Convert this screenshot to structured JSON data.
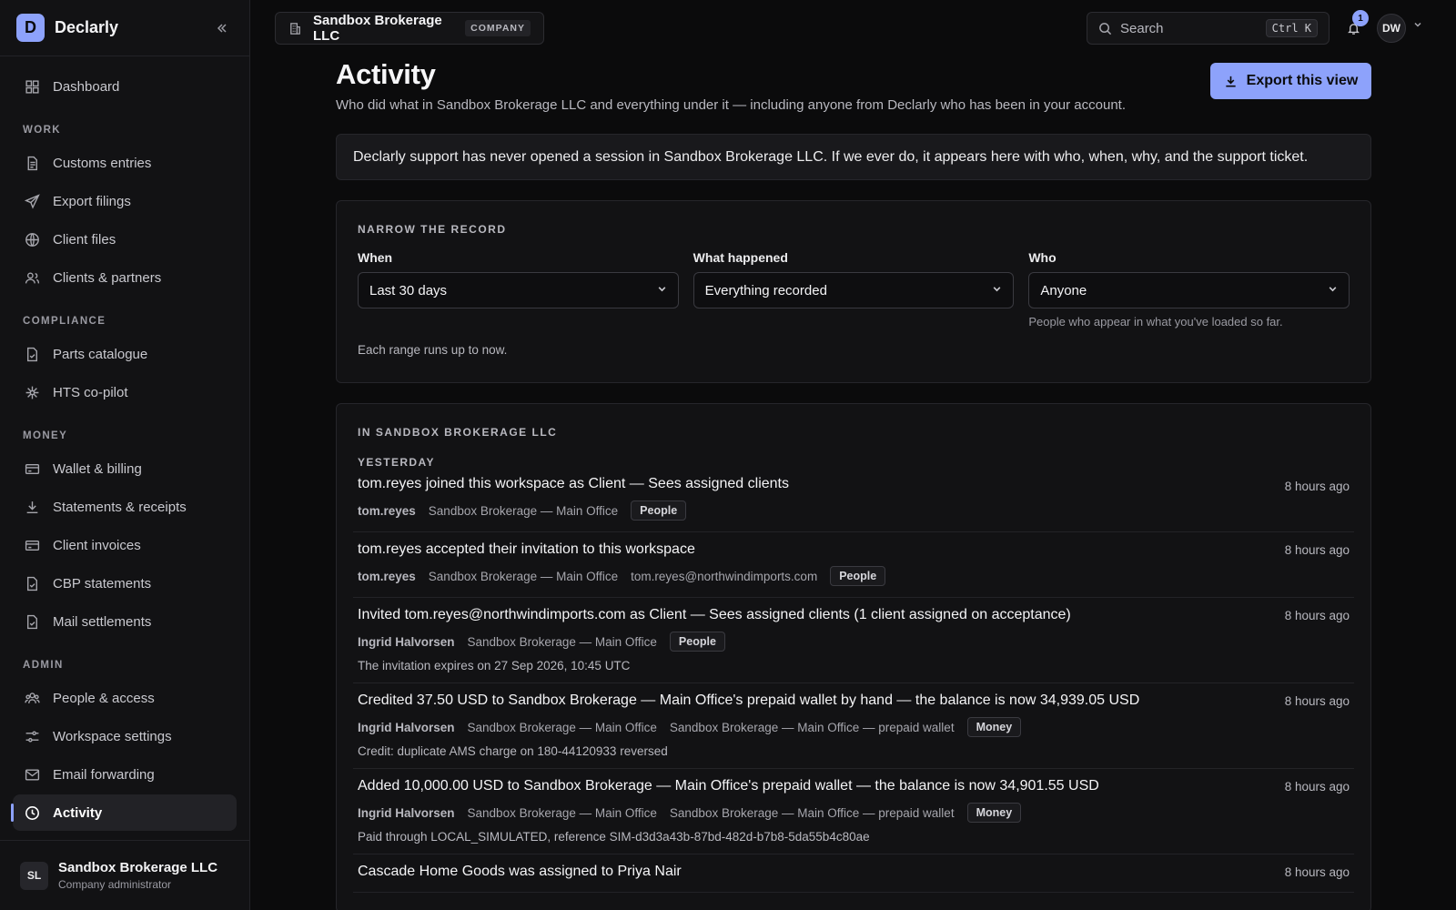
{
  "brand": {
    "logo_letter": "D",
    "name": "Declarly"
  },
  "sidebar": {
    "top_items": [
      {
        "label": "Dashboard",
        "icon": "grid-icon"
      }
    ],
    "sections": [
      {
        "title": "WORK",
        "items": [
          {
            "label": "Customs entries",
            "icon": "document-icon"
          },
          {
            "label": "Export filings",
            "icon": "send-icon"
          },
          {
            "label": "Client files",
            "icon": "globe-icon"
          },
          {
            "label": "Clients & partners",
            "icon": "users-icon"
          }
        ]
      },
      {
        "title": "COMPLIANCE",
        "items": [
          {
            "label": "Parts catalogue",
            "icon": "file-check-icon"
          },
          {
            "label": "HTS co-pilot",
            "icon": "sparkle-icon"
          }
        ]
      },
      {
        "title": "MONEY",
        "items": [
          {
            "label": "Wallet & billing",
            "icon": "card-icon"
          },
          {
            "label": "Statements & receipts",
            "icon": "download-icon"
          },
          {
            "label": "Client invoices",
            "icon": "card-icon"
          },
          {
            "label": "CBP statements",
            "icon": "file-check-icon"
          },
          {
            "label": "Mail settlements",
            "icon": "file-check-icon"
          }
        ]
      },
      {
        "title": "ADMIN",
        "items": [
          {
            "label": "People & access",
            "icon": "people-icon"
          },
          {
            "label": "Workspace settings",
            "icon": "sliders-icon"
          },
          {
            "label": "Email forwarding",
            "icon": "mail-icon"
          },
          {
            "label": "Activity",
            "icon": "clock-icon",
            "active": true
          }
        ]
      }
    ],
    "footer": {
      "avatar": "SL",
      "name": "Sandbox Brokerage LLC",
      "role": "Company administrator"
    }
  },
  "topbar": {
    "company": "Sandbox Brokerage LLC",
    "company_tag": "COMPANY",
    "search_label": "Search",
    "search_shortcut": "Ctrl K",
    "notification_count": "1",
    "user_initials": "DW"
  },
  "page": {
    "title": "Activity",
    "subtitle": "Who did what in Sandbox Brokerage LLC and everything under it — including anyone from Declarly who has been in your account.",
    "export_label": "Export this view",
    "notice": "Declarly support has never opened a session in Sandbox Brokerage LLC. If we ever do, it appears here with who, when, why, and the support ticket."
  },
  "filters": {
    "heading": "NARROW THE RECORD",
    "when": {
      "label": "When",
      "value": "Last 30 days"
    },
    "what": {
      "label": "What happened",
      "value": "Everything recorded"
    },
    "who": {
      "label": "Who",
      "value": "Anyone",
      "hint": "People who appear in what you've loaded so far."
    },
    "range_note": "Each range runs up to now."
  },
  "activity": {
    "heading": "IN SANDBOX BROKERAGE LLC",
    "day": "YESTERDAY",
    "entries": [
      {
        "title": "tom.reyes joined this workspace as Client — Sees assigned clients",
        "time": "8 hours ago",
        "actor": "tom.reyes",
        "meta": [
          "Sandbox Brokerage — Main Office"
        ],
        "tag": "People",
        "note": ""
      },
      {
        "title": "tom.reyes accepted their invitation to this workspace",
        "time": "8 hours ago",
        "actor": "tom.reyes",
        "meta": [
          "Sandbox Brokerage — Main Office",
          "tom.reyes@northwindimports.com"
        ],
        "tag": "People",
        "note": ""
      },
      {
        "title": "Invited tom.reyes@northwindimports.com as Client — Sees assigned clients (1 client assigned on acceptance)",
        "time": "8 hours ago",
        "actor": "Ingrid Halvorsen",
        "meta": [
          "Sandbox Brokerage — Main Office"
        ],
        "tag": "People",
        "note": "The invitation expires on 27 Sep 2026, 10:45 UTC"
      },
      {
        "title": "Credited 37.50 USD to Sandbox Brokerage — Main Office's prepaid wallet by hand — the balance is now 34,939.05 USD",
        "time": "8 hours ago",
        "actor": "Ingrid Halvorsen",
        "meta": [
          "Sandbox Brokerage — Main Office",
          "Sandbox Brokerage — Main Office — prepaid wallet"
        ],
        "tag": "Money",
        "note": "Credit: duplicate AMS charge on 180-44120933 reversed"
      },
      {
        "title": "Added 10,000.00 USD to Sandbox Brokerage — Main Office's prepaid wallet — the balance is now 34,901.55 USD",
        "time": "8 hours ago",
        "actor": "Ingrid Halvorsen",
        "meta": [
          "Sandbox Brokerage — Main Office",
          "Sandbox Brokerage — Main Office — prepaid wallet"
        ],
        "tag": "Money",
        "note": "Paid through LOCAL_SIMULATED, reference SIM-d3d3a43b-87bd-482d-b7b8-5da55b4c80ae"
      },
      {
        "title": "Cascade Home Goods was assigned to Priya Nair",
        "time": "8 hours ago",
        "actor": "",
        "meta": [],
        "tag": "",
        "note": ""
      }
    ]
  },
  "colors": {
    "accent": "#8da2fb",
    "background": "#0b0b0c",
    "sidebar": "#121214"
  }
}
